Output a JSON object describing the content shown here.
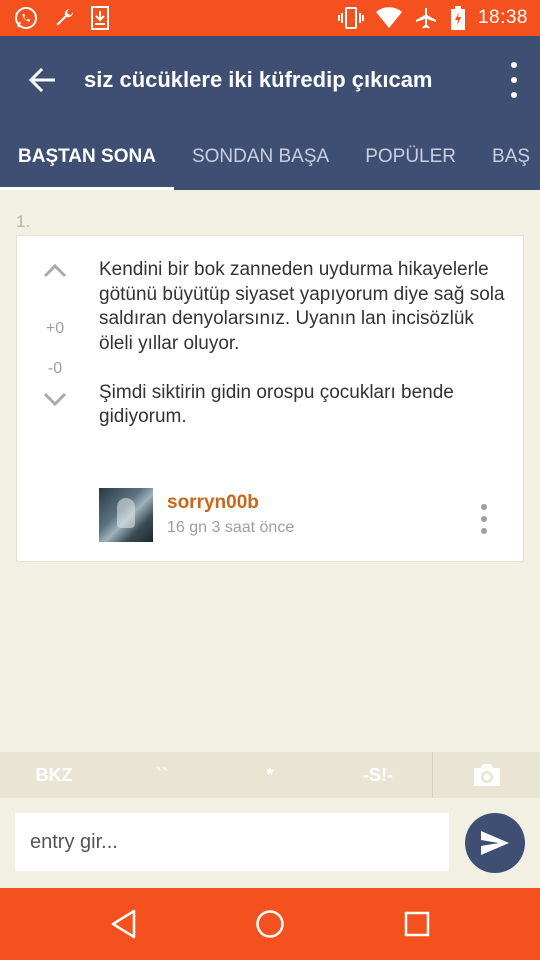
{
  "status_bar": {
    "time": "18:38",
    "left_icons": [
      "whatsapp-icon",
      "wrench-icon",
      "download-icon"
    ],
    "right_icons": [
      "vibrate-icon",
      "wifi-icon",
      "airplane-icon",
      "battery-charging-icon"
    ]
  },
  "toolbar": {
    "title": "siz cücüklere iki küfredip çıkıcam",
    "back_icon": "arrow-back-icon",
    "more_icon": "more-vert-icon"
  },
  "tabs": [
    {
      "label": "BAŞTAN SONA",
      "active": true
    },
    {
      "label": "SONDAN BAŞA",
      "active": false
    },
    {
      "label": "POPÜLER",
      "active": false
    },
    {
      "label": "BAŞ",
      "active": false
    }
  ],
  "entry": {
    "index": "1.",
    "upvotes": "+0",
    "downvotes": "-0",
    "paragraphs": [
      "Kendini bir bok zanneden uydurma hikayelerle götünü büyütüp siyaset yapıyorum diye sağ sola saldıran denyolarsınız. Uyanın lan incisözlük öleli yıllar oluyor.",
      "Şimdi siktirin gidin orospu çocukları bende gidiyorum."
    ],
    "author": "sorryn00b",
    "date": "16 gn 3 saat  önce"
  },
  "format_bar": {
    "bkz": "BKZ",
    "backtick": "``",
    "star": "*",
    "spoiler": "-S!-",
    "camera_icon": "camera-icon"
  },
  "input": {
    "placeholder": "entry gir...",
    "value": ""
  },
  "colors": {
    "status_bar": "#f4511e",
    "toolbar": "#3f4f74",
    "background": "#f2efe3",
    "author": "#c8661a",
    "send_button": "#3f4f74"
  }
}
